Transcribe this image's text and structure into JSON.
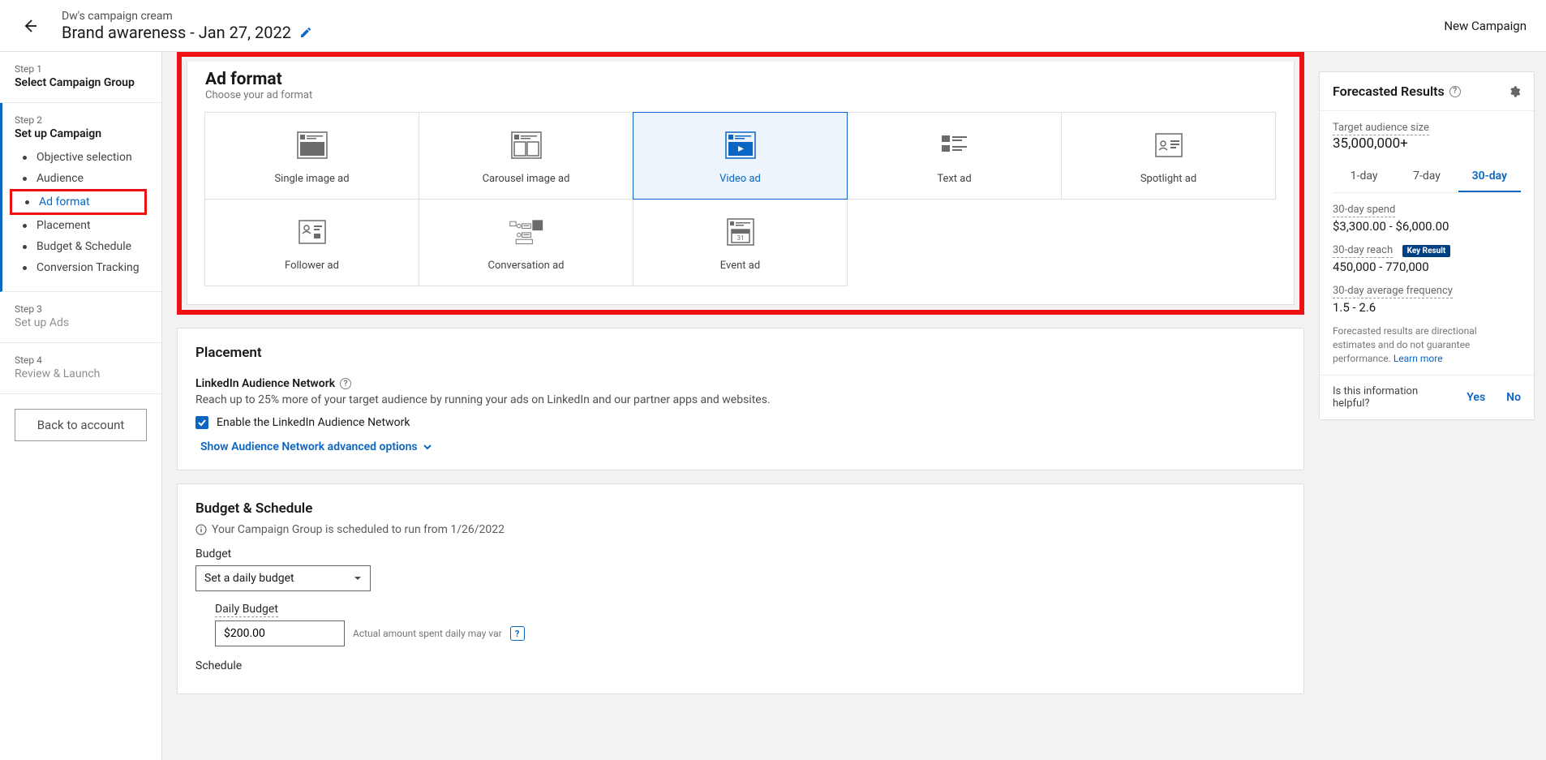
{
  "header": {
    "campaign_group": "Dw's campaign cream",
    "campaign_name": "Brand awareness - Jan 27, 2022",
    "right_label": "New Campaign"
  },
  "sidebar": {
    "steps": [
      {
        "label": "Step 1",
        "title": "Select Campaign Group"
      },
      {
        "label": "Step 2",
        "title": "Set up Campaign"
      },
      {
        "label": "Step 3",
        "title": "Set up Ads"
      },
      {
        "label": "Step 4",
        "title": "Review & Launch"
      }
    ],
    "substeps": [
      "Objective selection",
      "Audience",
      "Ad format",
      "Placement",
      "Budget & Schedule",
      "Conversion Tracking"
    ],
    "back_button": "Back to account"
  },
  "adformat": {
    "title": "Ad format",
    "subtitle": "Choose your ad format",
    "options": [
      "Single image ad",
      "Carousel image ad",
      "Video ad",
      "Text ad",
      "Spotlight ad",
      "Follower ad",
      "Conversation ad",
      "Event ad"
    ]
  },
  "placement": {
    "title": "Placement",
    "network_label": "LinkedIn Audience Network",
    "network_desc": "Reach up to 25% more of your target audience by running your ads on LinkedIn and our partner apps and websites.",
    "checkbox_label": "Enable the LinkedIn Audience Network",
    "advanced_link": "Show Audience Network advanced options"
  },
  "budget": {
    "title": "Budget & Schedule",
    "info_line": "Your Campaign Group is scheduled to run from 1/26/2022",
    "budget_label": "Budget",
    "budget_select_value": "Set a daily budget",
    "daily_budget_label": "Daily Budget",
    "daily_budget_value": "$200.00",
    "daily_hint": "Actual amount spent daily may var",
    "schedule_label": "Schedule"
  },
  "rail": {
    "title": "Forecasted Results",
    "audience_label": "Target audience size",
    "audience_value": "35,000,000+",
    "tabs": [
      "1-day",
      "7-day",
      "30-day"
    ],
    "spend_label": "30-day spend",
    "spend_value": "$3,300.00 - $6,000.00",
    "reach_label": "30-day reach",
    "key_result_badge": "Key Result",
    "reach_value": "450,000 - 770,000",
    "freq_label": "30-day average frequency",
    "freq_value": "1.5 - 2.6",
    "disclaimer": "Forecasted results are directional estimates and do not guarantee performance.",
    "learn_more": "Learn more",
    "feedback_q": "Is this information helpful?",
    "yes": "Yes",
    "no": "No"
  }
}
